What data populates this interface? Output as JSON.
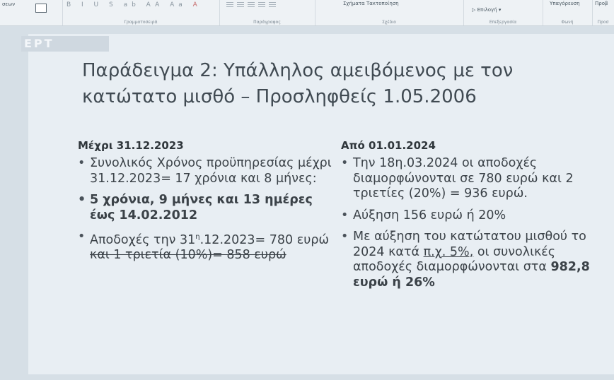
{
  "ribbon": {
    "left_label": "σεων",
    "group_font": "Γραμματοσειρά",
    "group_paragraph": "Παράγραφος",
    "group_drawing": "Σχέδιο",
    "arrange_label": "Σχήματα Τακτοποίηση",
    "group_editing": "Επεξεργασία",
    "select_label": "Επιλογή",
    "dictation_label": "Υπαγόρευση",
    "group_voice": "Φωνή",
    "designer_label": "Προβ",
    "designer_group": "Προσ"
  },
  "slide": {
    "logo": "ΕΡΤ",
    "title": "Παράδειγμα 2: Υπάλληλος αμειβόμενος με τον κατώτατο μισθό – Προσληφθείς 1.05.2006",
    "left": {
      "heading": "Μέχρι 31.12.2023",
      "b1": "Συνολικός Χρόνος προϋπηρεσίας μέχρι 31.12.2023= 17 χρόνια και 8 μήνες:",
      "b2": "5 χρόνια, 9 μήνες και 13 ημέρες έως 14.02.2012",
      "b3_pre": "Αποδοχές την 31",
      "b3_sup": "η",
      "b3_mid": ".12.2023= 780 ευρώ ",
      "b3_strike": "και 1 τριετία (10%)= 858 ευρώ"
    },
    "right": {
      "heading": "Από 01.01.2024",
      "b1": "Την 18η.03.2024 οι αποδοχές διαμορφώνονται σε 780 ευρώ και 2 τριετίες (20%) = 936 ευρώ.",
      "b2": "Αύξηση 156 ευρώ ή 20%",
      "b3_a": "Με αύξηση του κατώτατου μισθού το 2024 κατά ",
      "b3_u": "π.χ. 5%,",
      "b3_b": " οι συνολικές αποδοχές διαμορφώνονται στα ",
      "b3_bold": "982,8 ευρώ ή 26%"
    }
  }
}
